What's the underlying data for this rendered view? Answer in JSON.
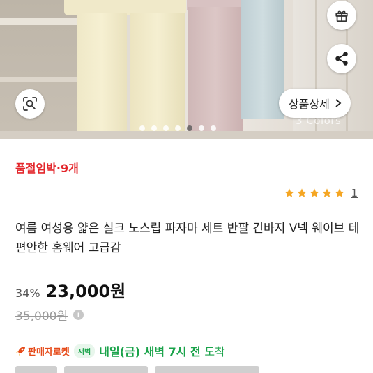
{
  "hero": {
    "watermark": "3 Colors",
    "detail_button_label": "상품상세",
    "icons": {
      "gift": "gift-icon",
      "share": "share-icon",
      "lens": "image-search-icon",
      "detail_arrow": "chevron-right-icon"
    },
    "carousel": {
      "total": 7,
      "active_index": 4
    }
  },
  "stock": {
    "label": "품절임박",
    "separator": "·",
    "count": "9개"
  },
  "rating": {
    "stars": 5,
    "review_count": "1"
  },
  "product": {
    "title": "여름 여성용 얇은 실크 노스립 파자마 세트 반팔 긴바지 V넥 웨이브 테 편안한 홈웨어 고급감"
  },
  "price": {
    "discount": "34%",
    "sale": "23,000원",
    "original": "35,000원"
  },
  "delivery": {
    "rocket_label": "판매자로켓",
    "dawn_badge": "새벽",
    "arrival_date": "내일(금) 새벽 7시 전",
    "arrival_suffix": "도착"
  },
  "colors": {
    "stock_red": "#e3262b",
    "star": "#f5a623",
    "rocket": "#e64a19",
    "delivery_green": "#1aa34a"
  }
}
